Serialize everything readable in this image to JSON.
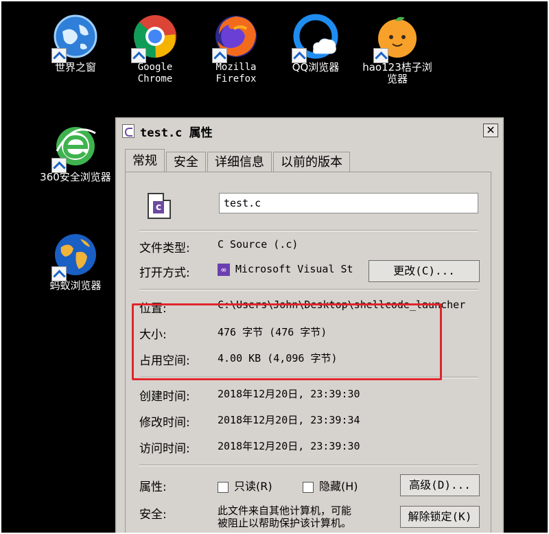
{
  "desktop": {
    "icons": [
      {
        "label": "世界之窗"
      },
      {
        "label": "Google Chrome"
      },
      {
        "label": "Mozilla Firefox"
      },
      {
        "label": "QQ浏览器"
      },
      {
        "label": "hao123桔子浏览器"
      },
      {
        "label": "360安全浏览器"
      },
      {
        "label": "蚂蚁浏览器"
      }
    ]
  },
  "dialog": {
    "title": "test.c 属性",
    "close_label": "✕",
    "tabs": [
      "常规",
      "安全",
      "详细信息",
      "以前的版本"
    ],
    "filename": "test.c",
    "file_icon_letter": "c",
    "type_label": "文件类型:",
    "type_value": "C Source (.c)",
    "open_with_label": "打开方式:",
    "open_with_value": "Microsoft Visual St",
    "change_button": "更改(C)...",
    "location_label": "位置:",
    "location_value": "C:\\Users\\John\\Desktop\\shellcode_launcher",
    "size_label": "大小:",
    "size_value": "476 字节 (476 字节)",
    "size_on_disk_label": "占用空间:",
    "size_on_disk_value": "4.00 KB (4,096 字节)",
    "created_label": "创建时间:",
    "created_value": "2018年12月20日, 23:39:30",
    "modified_label": "修改时间:",
    "modified_value": "2018年12月20日, 23:39:34",
    "accessed_label": "访问时间:",
    "accessed_value": "2018年12月20日, 23:39:30",
    "attributes_label": "属性:",
    "readonly_label": "只读(R)",
    "hidden_label": "隐藏(H)",
    "advanced_button": "高级(D)...",
    "security_label": "安全:",
    "security_text_1": "此文件来自其他计算机，可能",
    "security_text_2": "被阻止以帮助保护该计算机。",
    "unblock_button": "解除锁定(K)"
  },
  "colors": {
    "highlight": "#e0242b",
    "dialog_bg": "#d6d3ce"
  }
}
